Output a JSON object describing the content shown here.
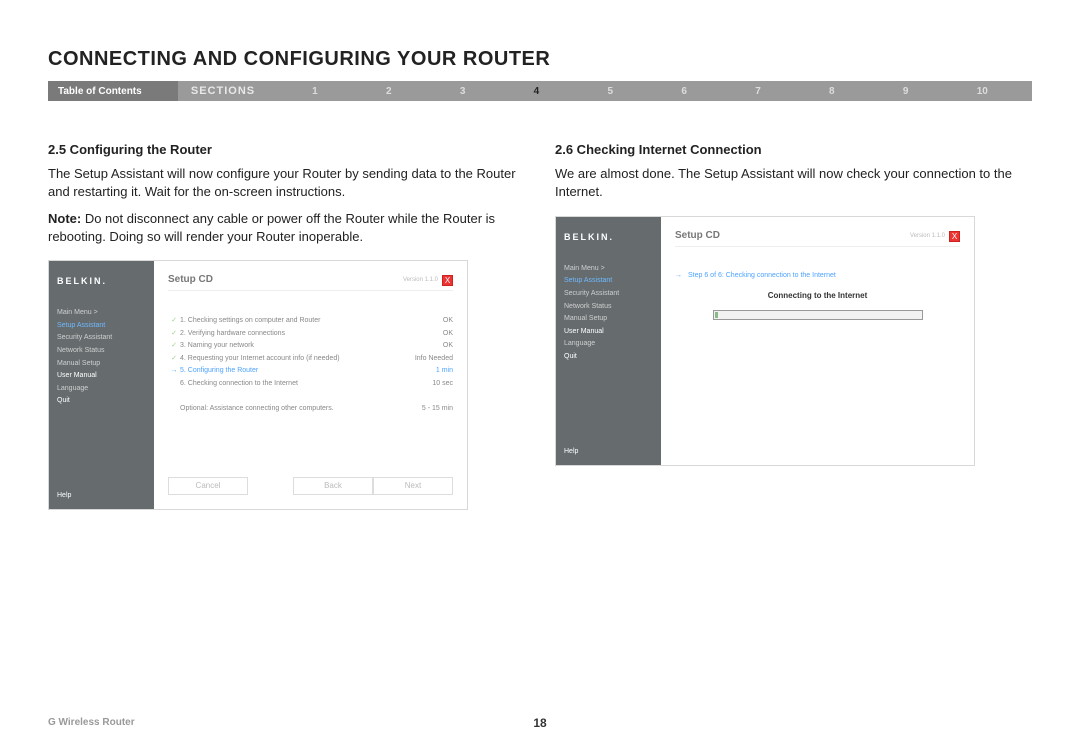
{
  "page_title": "CONNECTING AND CONFIGURING YOUR ROUTER",
  "nav": {
    "toc": "Table of Contents",
    "sections": "SECTIONS",
    "numbers": [
      "1",
      "2",
      "3",
      "4",
      "5",
      "6",
      "7",
      "8",
      "9",
      "10"
    ],
    "active": "4"
  },
  "left": {
    "heading": "2.5 Configuring the Router",
    "p1": "The Setup Assistant will now configure your Router by sending data to the Router and restarting it. Wait for the on-screen instructions.",
    "p2_label": "Note:",
    "p2": " Do not disconnect any cable or power off the Router while the Router is rebooting. Doing so will render your Router inoperable."
  },
  "right": {
    "heading": "2.6 Checking Internet Connection",
    "p1": "We are almost done. The Setup Assistant will now check your connection to the Internet."
  },
  "shot_common": {
    "logo": "BELKIN.",
    "title": "Setup CD",
    "version": "Version 1.1.0",
    "close": "X",
    "menu": {
      "main": "Main Menu  >",
      "setup": "Setup Assistant",
      "security": "Security Assistant",
      "network": "Network Status",
      "manual": "Manual Setup",
      "user_manual": "User Manual",
      "language": "Language",
      "quit": "Quit",
      "help": "Help"
    },
    "buttons": {
      "cancel": "Cancel",
      "back": "Back",
      "next": "Next"
    }
  },
  "shot1": {
    "steps": [
      {
        "ico": "check",
        "txt": "1. Checking settings on computer and Router",
        "status": "OK"
      },
      {
        "ico": "check",
        "txt": "2. Verifying hardware connections",
        "status": "OK"
      },
      {
        "ico": "check",
        "txt": "3. Naming your network",
        "status": "OK"
      },
      {
        "ico": "check",
        "txt": "4. Requesting your Internet account info (if needed)",
        "status": "Info Needed"
      },
      {
        "ico": "arrow",
        "txt": "5. Configuring the Router",
        "status": "1 min",
        "active": true
      },
      {
        "ico": "",
        "txt": "6. Checking connection to the Internet",
        "status": "10 sec"
      }
    ],
    "optional": {
      "txt": "Optional: Assistance connecting other computers.",
      "status": "5 - 15 min"
    }
  },
  "shot2": {
    "step_label": "Step 6 of 6: Checking connection to the Internet",
    "connecting": "Connecting to the Internet"
  },
  "footer": {
    "product": "G Wireless Router",
    "page": "18"
  }
}
